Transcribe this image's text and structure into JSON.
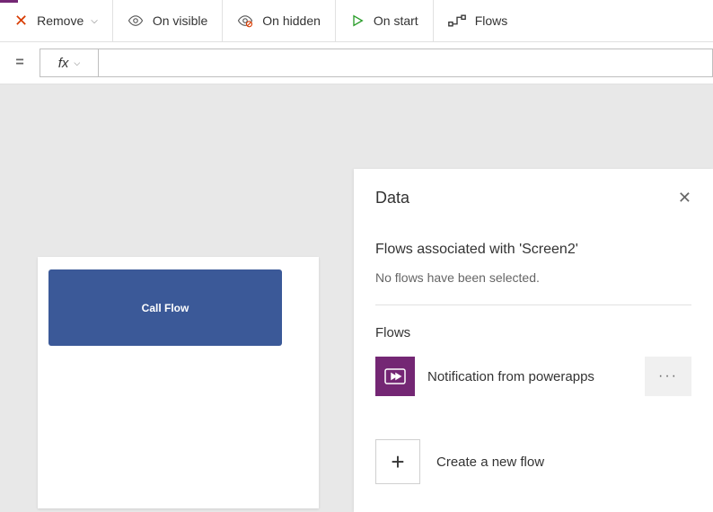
{
  "toolbar": {
    "remove_label": "Remove",
    "on_visible_label": "On visible",
    "on_hidden_label": "On hidden",
    "on_start_label": "On start",
    "flows_label": "Flows"
  },
  "formula_bar": {
    "equals": "=",
    "fx": "fx",
    "value": ""
  },
  "canvas": {
    "call_flow_label": "Call Flow"
  },
  "panel": {
    "title": "Data",
    "associated_title": "Flows associated with 'Screen2'",
    "associated_empty": "No flows have been selected.",
    "flows_heading": "Flows",
    "flow_items": [
      {
        "name": "Notification from powerapps"
      }
    ],
    "more_label": "···",
    "create_label": "Create a new flow"
  },
  "colors": {
    "accent_purple": "#742774",
    "button_blue": "#3b5998",
    "remove_red": "#d83b01"
  }
}
